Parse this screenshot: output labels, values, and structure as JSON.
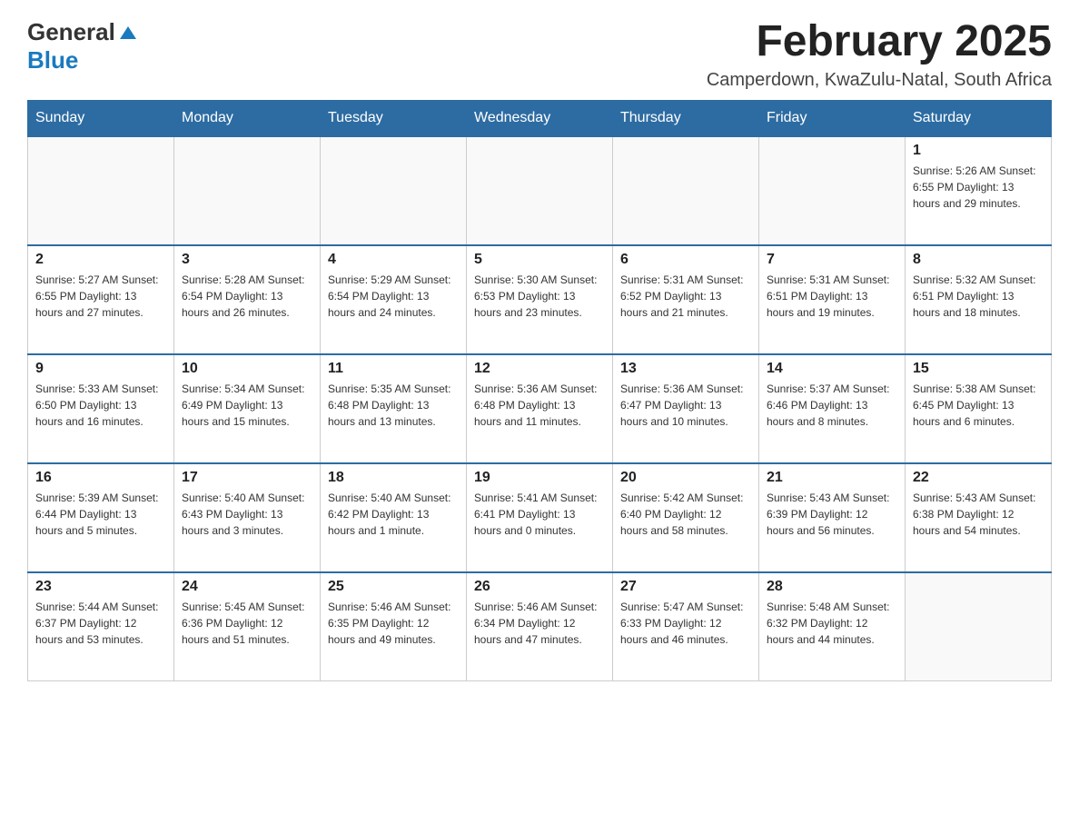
{
  "header": {
    "logo_line1": "General",
    "logo_line2": "Blue",
    "month_title": "February 2025",
    "location": "Camperdown, KwaZulu-Natal, South Africa"
  },
  "weekdays": [
    "Sunday",
    "Monday",
    "Tuesday",
    "Wednesday",
    "Thursday",
    "Friday",
    "Saturday"
  ],
  "weeks": [
    [
      {
        "day": "",
        "info": ""
      },
      {
        "day": "",
        "info": ""
      },
      {
        "day": "",
        "info": ""
      },
      {
        "day": "",
        "info": ""
      },
      {
        "day": "",
        "info": ""
      },
      {
        "day": "",
        "info": ""
      },
      {
        "day": "1",
        "info": "Sunrise: 5:26 AM\nSunset: 6:55 PM\nDaylight: 13 hours\nand 29 minutes."
      }
    ],
    [
      {
        "day": "2",
        "info": "Sunrise: 5:27 AM\nSunset: 6:55 PM\nDaylight: 13 hours\nand 27 minutes."
      },
      {
        "day": "3",
        "info": "Sunrise: 5:28 AM\nSunset: 6:54 PM\nDaylight: 13 hours\nand 26 minutes."
      },
      {
        "day": "4",
        "info": "Sunrise: 5:29 AM\nSunset: 6:54 PM\nDaylight: 13 hours\nand 24 minutes."
      },
      {
        "day": "5",
        "info": "Sunrise: 5:30 AM\nSunset: 6:53 PM\nDaylight: 13 hours\nand 23 minutes."
      },
      {
        "day": "6",
        "info": "Sunrise: 5:31 AM\nSunset: 6:52 PM\nDaylight: 13 hours\nand 21 minutes."
      },
      {
        "day": "7",
        "info": "Sunrise: 5:31 AM\nSunset: 6:51 PM\nDaylight: 13 hours\nand 19 minutes."
      },
      {
        "day": "8",
        "info": "Sunrise: 5:32 AM\nSunset: 6:51 PM\nDaylight: 13 hours\nand 18 minutes."
      }
    ],
    [
      {
        "day": "9",
        "info": "Sunrise: 5:33 AM\nSunset: 6:50 PM\nDaylight: 13 hours\nand 16 minutes."
      },
      {
        "day": "10",
        "info": "Sunrise: 5:34 AM\nSunset: 6:49 PM\nDaylight: 13 hours\nand 15 minutes."
      },
      {
        "day": "11",
        "info": "Sunrise: 5:35 AM\nSunset: 6:48 PM\nDaylight: 13 hours\nand 13 minutes."
      },
      {
        "day": "12",
        "info": "Sunrise: 5:36 AM\nSunset: 6:48 PM\nDaylight: 13 hours\nand 11 minutes."
      },
      {
        "day": "13",
        "info": "Sunrise: 5:36 AM\nSunset: 6:47 PM\nDaylight: 13 hours\nand 10 minutes."
      },
      {
        "day": "14",
        "info": "Sunrise: 5:37 AM\nSunset: 6:46 PM\nDaylight: 13 hours\nand 8 minutes."
      },
      {
        "day": "15",
        "info": "Sunrise: 5:38 AM\nSunset: 6:45 PM\nDaylight: 13 hours\nand 6 minutes."
      }
    ],
    [
      {
        "day": "16",
        "info": "Sunrise: 5:39 AM\nSunset: 6:44 PM\nDaylight: 13 hours\nand 5 minutes."
      },
      {
        "day": "17",
        "info": "Sunrise: 5:40 AM\nSunset: 6:43 PM\nDaylight: 13 hours\nand 3 minutes."
      },
      {
        "day": "18",
        "info": "Sunrise: 5:40 AM\nSunset: 6:42 PM\nDaylight: 13 hours\nand 1 minute."
      },
      {
        "day": "19",
        "info": "Sunrise: 5:41 AM\nSunset: 6:41 PM\nDaylight: 13 hours\nand 0 minutes."
      },
      {
        "day": "20",
        "info": "Sunrise: 5:42 AM\nSunset: 6:40 PM\nDaylight: 12 hours\nand 58 minutes."
      },
      {
        "day": "21",
        "info": "Sunrise: 5:43 AM\nSunset: 6:39 PM\nDaylight: 12 hours\nand 56 minutes."
      },
      {
        "day": "22",
        "info": "Sunrise: 5:43 AM\nSunset: 6:38 PM\nDaylight: 12 hours\nand 54 minutes."
      }
    ],
    [
      {
        "day": "23",
        "info": "Sunrise: 5:44 AM\nSunset: 6:37 PM\nDaylight: 12 hours\nand 53 minutes."
      },
      {
        "day": "24",
        "info": "Sunrise: 5:45 AM\nSunset: 6:36 PM\nDaylight: 12 hours\nand 51 minutes."
      },
      {
        "day": "25",
        "info": "Sunrise: 5:46 AM\nSunset: 6:35 PM\nDaylight: 12 hours\nand 49 minutes."
      },
      {
        "day": "26",
        "info": "Sunrise: 5:46 AM\nSunset: 6:34 PM\nDaylight: 12 hours\nand 47 minutes."
      },
      {
        "day": "27",
        "info": "Sunrise: 5:47 AM\nSunset: 6:33 PM\nDaylight: 12 hours\nand 46 minutes."
      },
      {
        "day": "28",
        "info": "Sunrise: 5:48 AM\nSunset: 6:32 PM\nDaylight: 12 hours\nand 44 minutes."
      },
      {
        "day": "",
        "info": ""
      }
    ]
  ]
}
